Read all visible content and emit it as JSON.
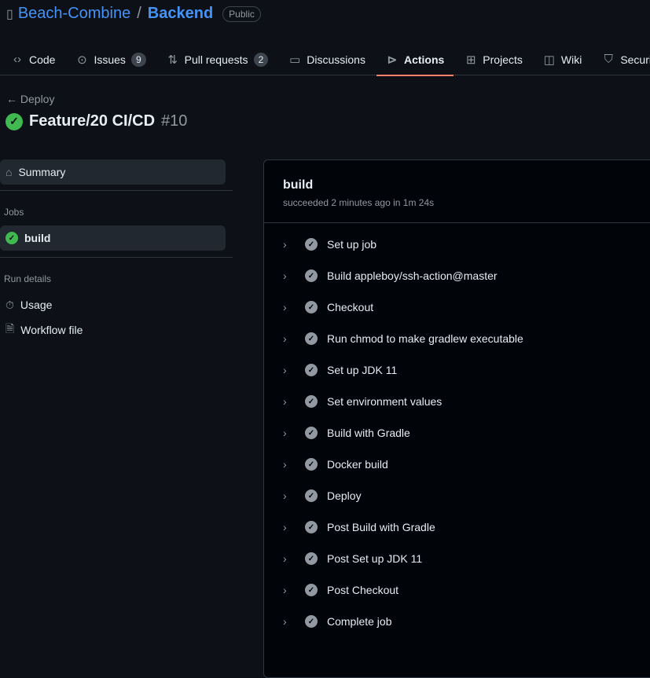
{
  "repo": {
    "owner": "Beach-Combine",
    "separator": "/",
    "name": "Backend",
    "visibility": "Public"
  },
  "nav": [
    {
      "label": "Code",
      "icon": "code-icon"
    },
    {
      "label": "Issues",
      "icon": "issue-icon",
      "count": "9"
    },
    {
      "label": "Pull requests",
      "icon": "pull-request-icon",
      "count": "2"
    },
    {
      "label": "Discussions",
      "icon": "discussion-icon"
    },
    {
      "label": "Actions",
      "icon": "play-icon",
      "active": true
    },
    {
      "label": "Projects",
      "icon": "table-icon"
    },
    {
      "label": "Wiki",
      "icon": "book-icon"
    },
    {
      "label": "Security",
      "icon": "shield-icon"
    }
  ],
  "run": {
    "back_label": "Deploy",
    "title": "Feature/20 CI/CD",
    "number": "#10",
    "status": "success",
    "accent": "#3fb950"
  },
  "sidebar": {
    "summary": "Summary",
    "jobs_heading": "Jobs",
    "job": "build",
    "run_details_heading": "Run details",
    "usage": "Usage",
    "workflow_file": "Workflow file"
  },
  "job": {
    "name": "build",
    "status_text": "succeeded 2 minutes ago in 1m 24s",
    "steps": [
      "Set up job",
      "Build appleboy/ssh-action@master",
      "Checkout",
      "Run chmod to make gradlew executable",
      "Set up JDK 11",
      "Set environment values",
      "Build with Gradle",
      "Docker build",
      "Deploy",
      "Post Build with Gradle",
      "Post Set up JDK 11",
      "Post Checkout",
      "Complete job"
    ]
  }
}
